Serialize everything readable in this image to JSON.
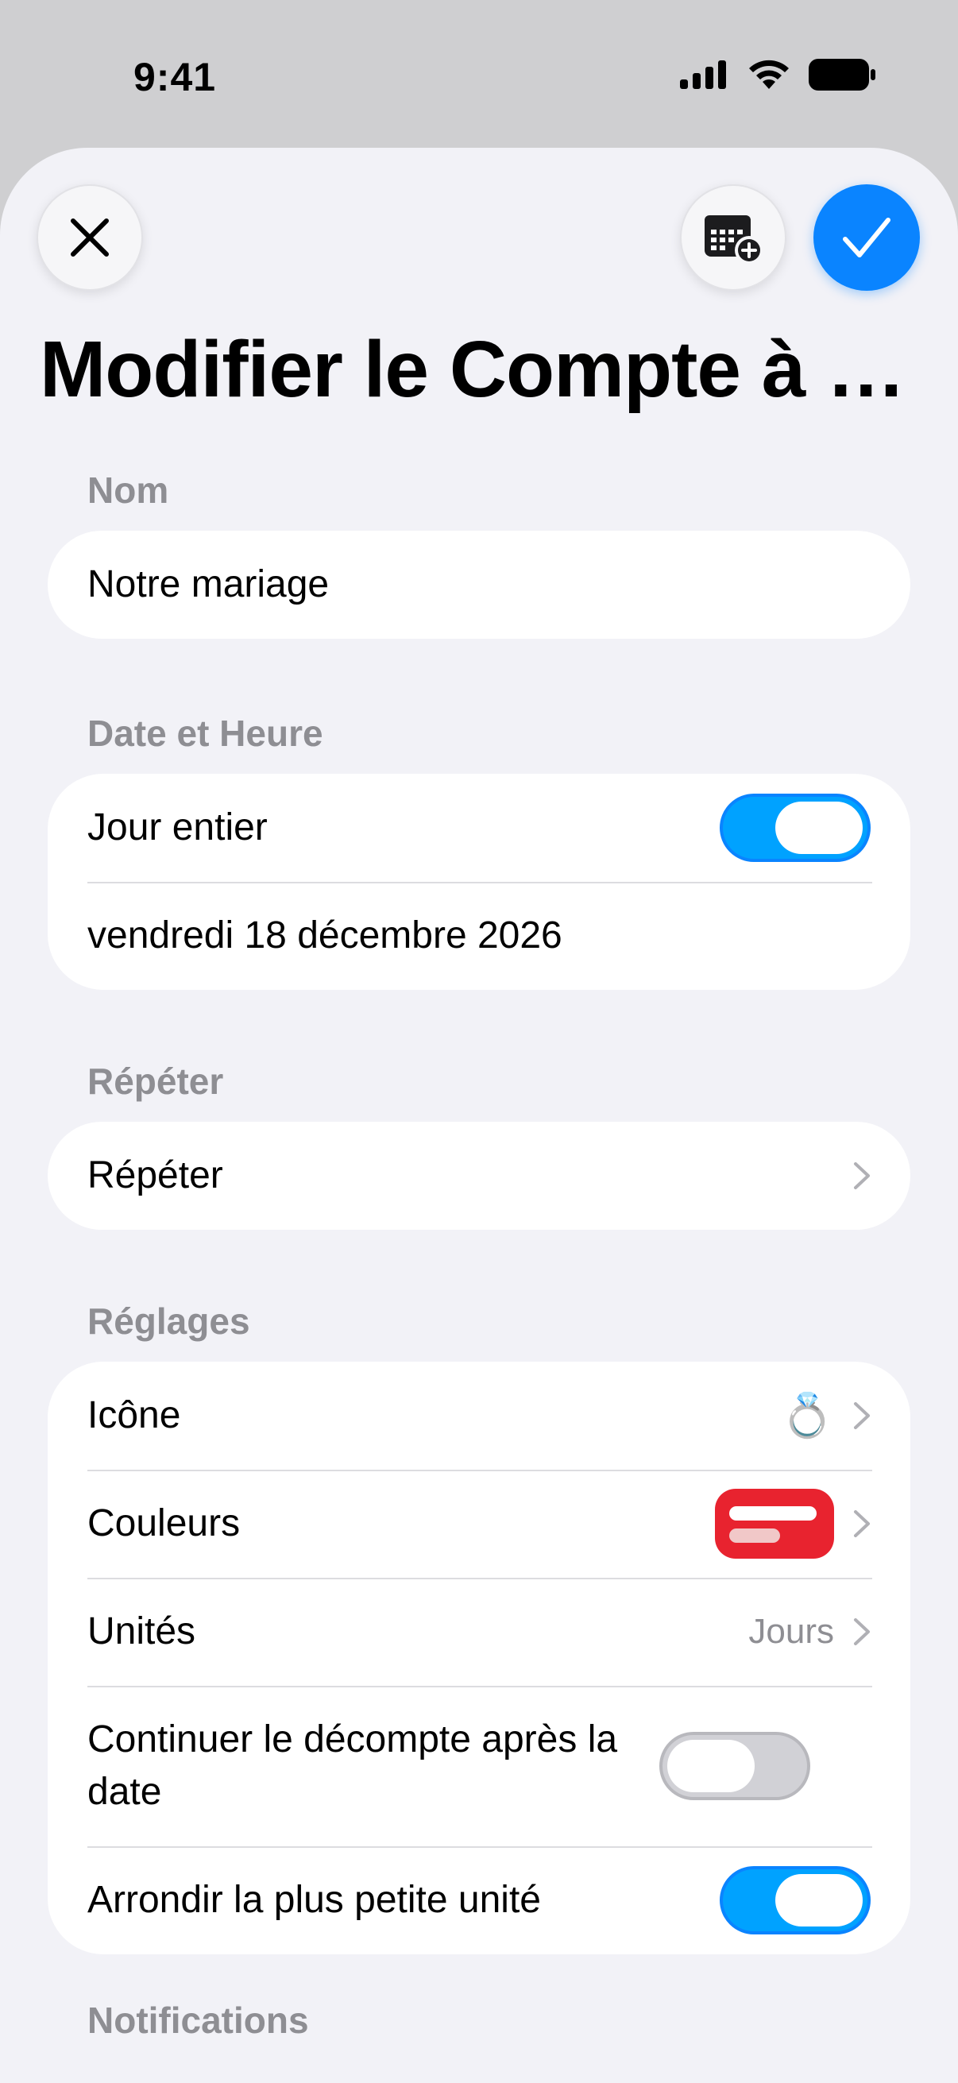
{
  "status": {
    "time": "9:41"
  },
  "sheet": {
    "title": "Modifier le Compte à r…",
    "sections": {
      "name": {
        "header": "Nom",
        "value": "Notre mariage"
      },
      "datetime": {
        "header": "Date et Heure",
        "all_day_label": "Jour entier",
        "all_day_on": true,
        "date_value": "vendredi 18 décembre 2026"
      },
      "repeat": {
        "header": "Répéter",
        "row_label": "Répéter"
      },
      "settings": {
        "header": "Réglages",
        "icon_label": "Icône",
        "icon_value": "💍",
        "colors_label": "Couleurs",
        "color_primary": "#e8232f",
        "units_label": "Unités",
        "units_value": "Jours",
        "continue_label": "Continuer le décompte après la date",
        "continue_on": false,
        "round_label": "Arrondir la plus petite unité",
        "round_on": true
      },
      "notifications": {
        "header": "Notifications"
      }
    }
  },
  "icons": [
    "close-icon",
    "calendar-add-icon",
    "checkmark-icon",
    "chevron-right-icon",
    "cellular-icon",
    "wifi-icon",
    "battery-icon"
  ],
  "accent": "#0a84ff"
}
